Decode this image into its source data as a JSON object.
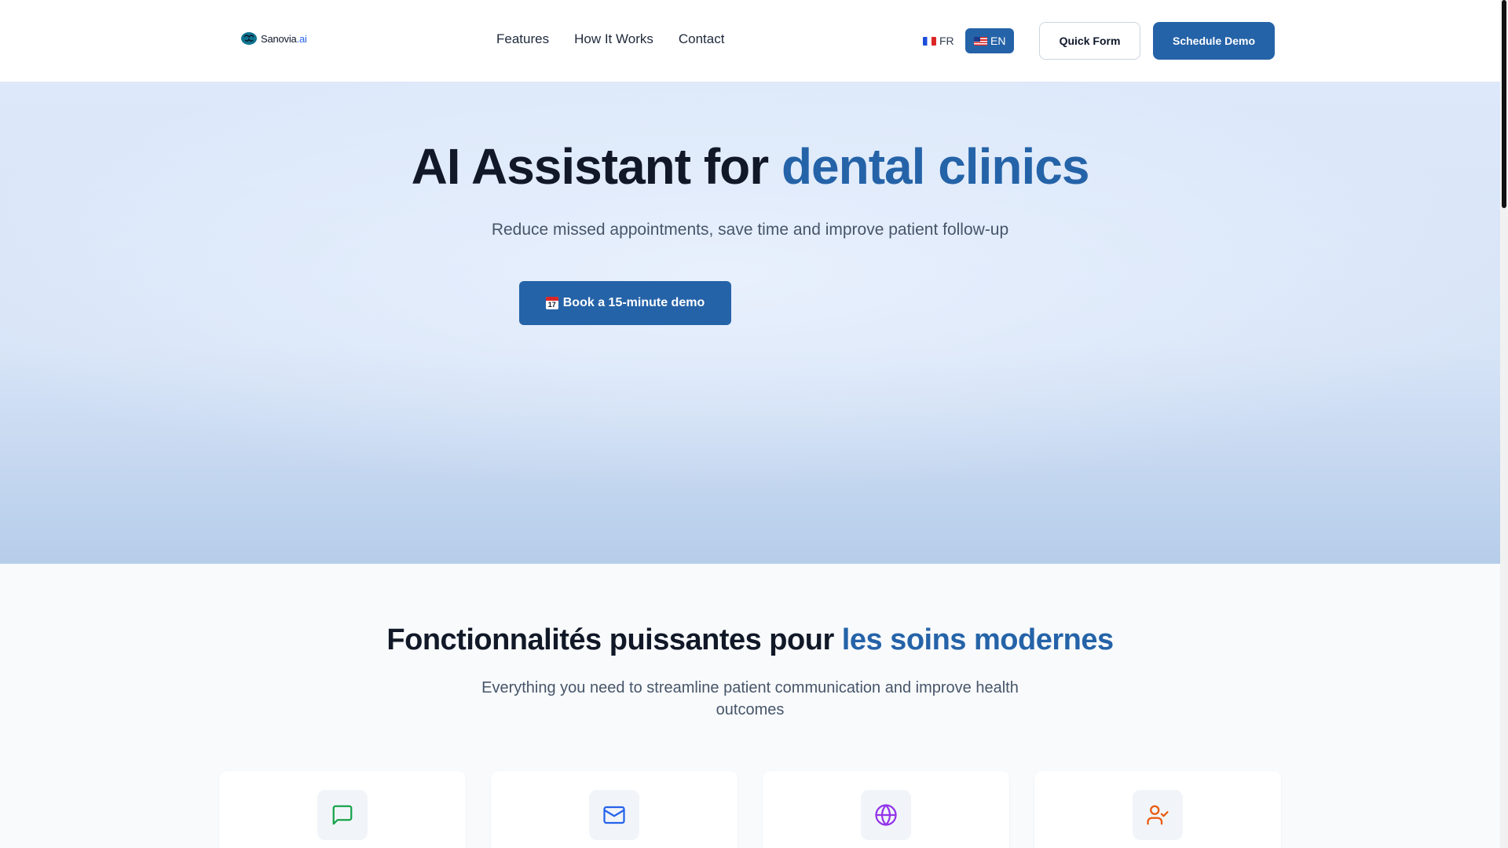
{
  "header": {
    "logo_text": "Sanovia",
    "logo_suffix": ".ai",
    "nav": [
      "Features",
      "How It Works",
      "Contact"
    ],
    "lang_fr": "FR",
    "lang_en": "EN",
    "quick_form": "Quick Form",
    "schedule_demo": "Schedule Demo"
  },
  "hero": {
    "title_main": "AI Assistant for ",
    "title_accent": "dental clinics",
    "subtitle": "Reduce missed appointments, save time and improve patient follow-up",
    "cta": "Book a 15-minute demo"
  },
  "features": {
    "title_main": "Fonctionnalités puissantes pour ",
    "title_accent": "les soins modernes",
    "subtitle": "Everything you need to streamline patient communication and improve health outcomes",
    "cards": [
      {
        "icon": "message-square-icon",
        "color": "#16a34a"
      },
      {
        "icon": "mail-icon",
        "color": "#2563eb"
      },
      {
        "icon": "globe-icon",
        "color": "#9333ea"
      },
      {
        "icon": "user-check-icon",
        "color": "#ea580c"
      }
    ]
  },
  "colors": {
    "primary": "#2563a8",
    "accent_text": "#2563a8"
  }
}
